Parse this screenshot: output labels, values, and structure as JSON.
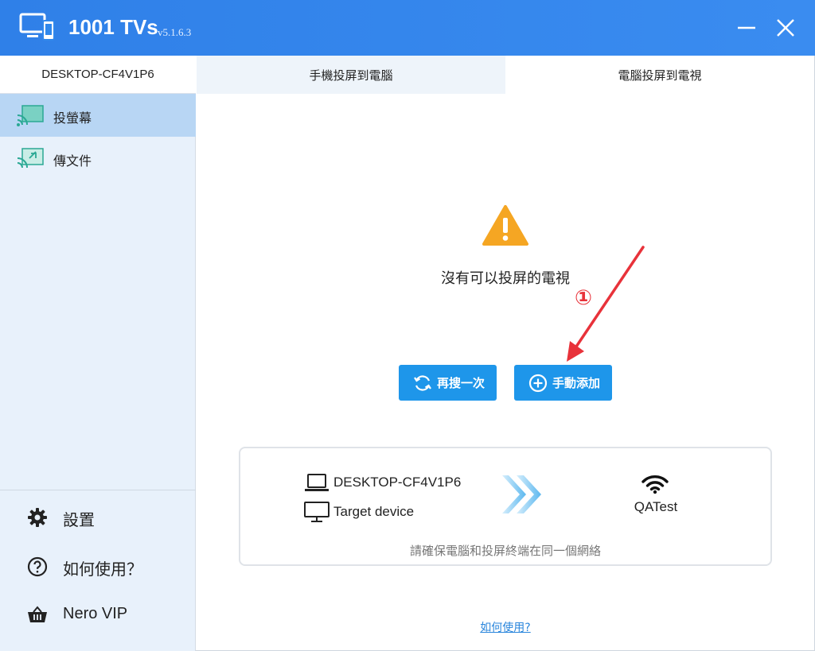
{
  "app": {
    "name": "1001 TVs",
    "version": "v5.1.6.3",
    "colors": {
      "titlebar": "#3088ec",
      "accent": "#1e96ea",
      "sidebar_bg": "#e8f1fb",
      "active_item": "#b8d6f4",
      "warning": "#f5a623",
      "annotation": "#e8323a"
    }
  },
  "window_controls": {
    "minimize_icon": "minimize-icon",
    "close_icon": "close-icon"
  },
  "sidebar": {
    "device_name": "DESKTOP-CF4V1P6",
    "items": [
      {
        "label": "投螢幕",
        "icon": "screen-cast-icon",
        "active": true
      },
      {
        "label": "傳文件",
        "icon": "file-transfer-icon",
        "active": false
      }
    ],
    "bottom": [
      {
        "label": "設置",
        "icon": "gear-icon"
      },
      {
        "label": "如何使用？",
        "icon": "help-circle-icon"
      },
      {
        "label": "Nero VIP",
        "icon": "basket-icon"
      }
    ]
  },
  "tabs": [
    {
      "label": "手機投屏到電腦",
      "active": false
    },
    {
      "label": "電腦投屏到電視",
      "active": true
    }
  ],
  "main": {
    "warning_icon": "warning-icon",
    "message": "沒有可以投屏的電視",
    "annotation": "①",
    "buttons": {
      "rescan": "再搜一次",
      "add_manual": "手動添加"
    },
    "info": {
      "source_device": "DESKTOP-CF4V1P6",
      "target_device": "Target device",
      "network": "QATest",
      "hint": "請確保電腦和投屏終端在同一個網絡"
    },
    "help_link": "如何使用?"
  }
}
